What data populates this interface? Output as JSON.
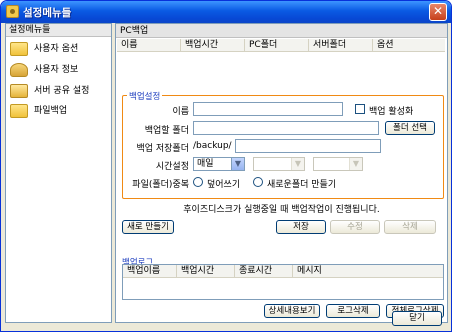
{
  "window": {
    "title": "설정메뉴들",
    "close": "✕"
  },
  "sidebar": {
    "header": "설정메뉴들",
    "items": [
      {
        "label": "사용자 옵션",
        "icon": "folder-icon"
      },
      {
        "label": "사용자 정보",
        "icon": "user-icon"
      },
      {
        "label": "서버 공유 설정",
        "icon": "share-icon"
      },
      {
        "label": "파일백업",
        "icon": "backup-icon"
      }
    ]
  },
  "main": {
    "header": "PC백업",
    "columns": [
      "이름",
      "백업시간",
      "PC폴더",
      "서버폴더",
      "옵션"
    ]
  },
  "settings": {
    "title": "백업설정",
    "name_label": "이름",
    "name_value": "",
    "enable_label": "백업 활성화",
    "source_label": "백업할 폴더",
    "source_value": "",
    "select_folder_button": "폴더 선택",
    "target_label": "백업 저장폴더",
    "target_prefix": "/backup/",
    "target_value": "",
    "time_label": "시간설정",
    "time_value": "매일",
    "mode_label": "파일(폴더)중복",
    "mode_overwrite": "덮어쓰기",
    "mode_newfolder": "새로운폴더 만들기"
  },
  "notice": "후이즈디스크가 실행중일 때 백업작업이 진행됩니다.",
  "actions": {
    "new": "새로 만들기",
    "save": "저장",
    "edit": "수정",
    "delete": "삭제"
  },
  "log": {
    "title": "백업로그",
    "columns": [
      "백업이름",
      "백업시간",
      "종료시간",
      "메시지"
    ],
    "detail_button": "상세내용보기",
    "delete_button": "로그삭제",
    "delete_all_button": "전체로그삭제"
  },
  "footer": {
    "close_button": "닫기"
  }
}
